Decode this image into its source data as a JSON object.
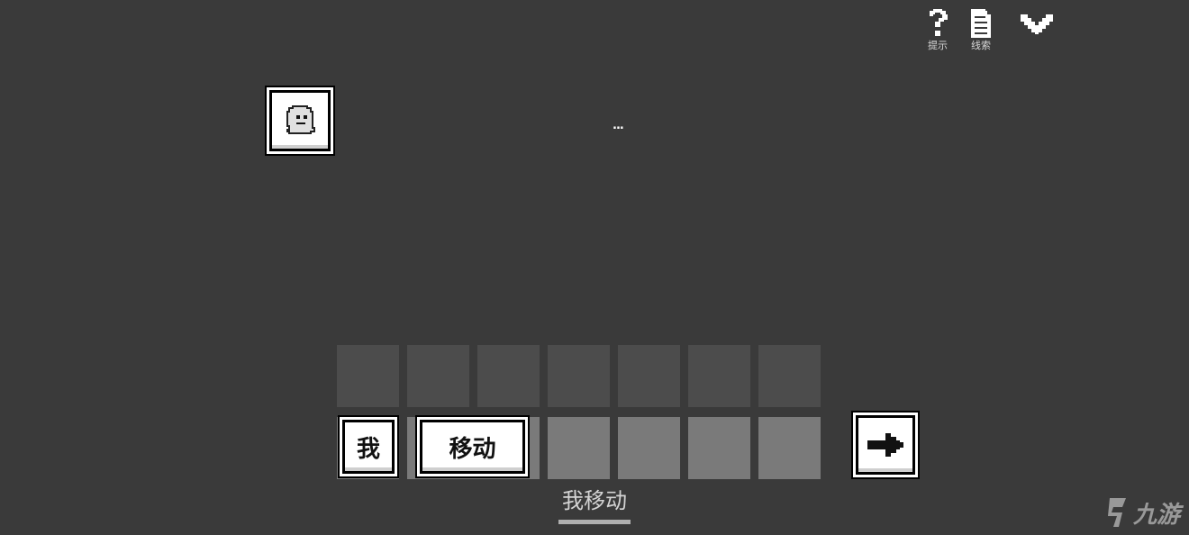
{
  "toolbar": {
    "hint_label": "提示",
    "clues_label": "线索",
    "hint_icon": "question-mark-icon",
    "clues_icon": "document-icon",
    "collapse_icon": "chevron-down-icon"
  },
  "scene": {
    "avatar_icon": "ghost-icon",
    "speech": "..."
  },
  "slots": {
    "upper_count": 7,
    "lower_count": 7
  },
  "tiles": {
    "wo": "我",
    "move": "移动"
  },
  "next_icon": "arrow-right-icon",
  "sentence": "我移动",
  "watermark": "九游",
  "colors": {
    "background": "#3a3a3a",
    "upper_slot": "#4c4c4c",
    "lower_slot": "#7a7a7a",
    "tile": "#ffffff"
  }
}
